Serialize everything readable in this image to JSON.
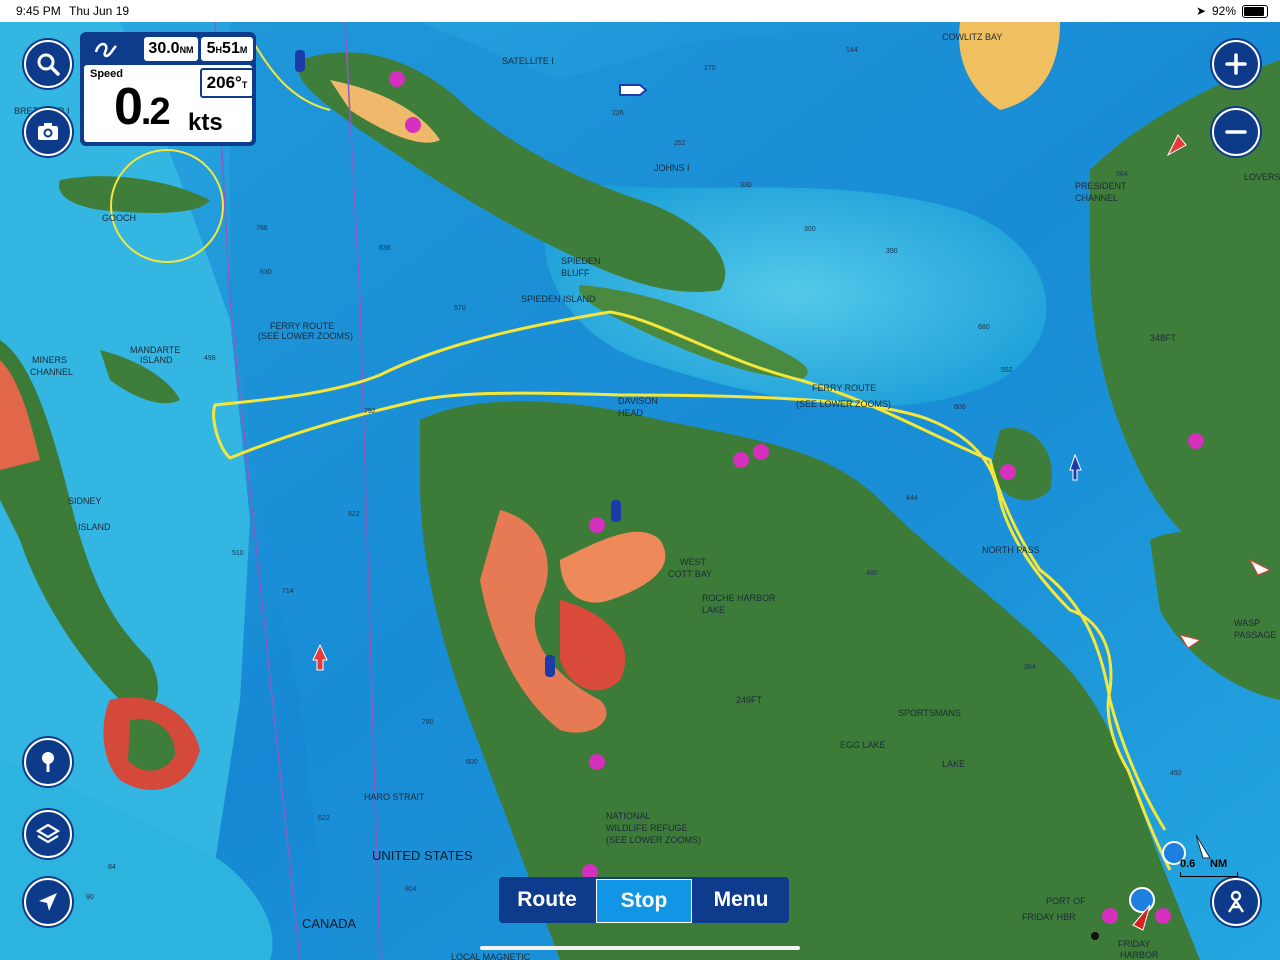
{
  "status_bar": {
    "time": "9:45 PM",
    "date": "Thu Jun 19",
    "battery": "92%"
  },
  "trip_panel": {
    "distance_value": "30.0",
    "distance_unit": "NM",
    "duration_hours": "5",
    "duration_h": "H",
    "duration_minutes": "51",
    "duration_m": "M",
    "speed_label": "Speed",
    "speed_int": "0",
    "speed_dec": ".2",
    "speed_unit": "kts",
    "heading": "206°",
    "heading_ref": "T"
  },
  "controls": {
    "search": "search-icon",
    "camera": "camera-icon",
    "zoom_in": "plus-icon",
    "zoom_out": "minus-icon",
    "pin": "pin-icon",
    "layers": "layers-icon",
    "locate": "location-arrow-icon",
    "avatar": "person-icon"
  },
  "tabs": [
    {
      "label": "Route",
      "active": false
    },
    {
      "label": "Stop",
      "active": true
    },
    {
      "label": "Menu",
      "active": false
    }
  ],
  "scale_bar": {
    "value": "0.6",
    "unit": "NM"
  },
  "map_labels": [
    "COWLITZ BAY",
    "SATELLITE I",
    "JOHNS I",
    "PRESIDENT",
    "CHANNEL",
    "SPIEDEN",
    "BLUFF",
    "SPIEDEN ISLAND",
    "FERRY ROUTE",
    "(SEE LOWER ZOOMS)",
    "MANDARTE",
    "ISLAND",
    "MINERS",
    "CHANNEL",
    "SIDNEY",
    "ISLAND",
    "DAVISON",
    "HEAD",
    "FERRY ROUTE",
    "(SEE LOWER ZOOMS)",
    "WEST",
    "COTT BAY",
    "ROCHE HARBOR",
    "LAKE",
    "NORTH PASS",
    "WASP",
    "PASSAGE",
    "249FT",
    "348FT",
    "SPORTSMANS",
    "LAKE",
    "EGG LAKE",
    "HARO STRAIT",
    "NATIONAL",
    "WILDLIFE REFUGE",
    "(SEE LOWER ZOOMS)",
    "UNITED STATES",
    "CANADA",
    "PORT OF",
    "FRIDAY HBR",
    "FRIDAY",
    "HARBOR",
    "LOCAL MAGNETIC",
    "GOOCH",
    "BRETHOUR I",
    "LOVERS"
  ],
  "depths": [
    "270",
    "226",
    "252",
    "144",
    "330",
    "300",
    "390",
    "680",
    "552",
    "606",
    "564",
    "498",
    "792",
    "822",
    "630",
    "636",
    "570",
    "444",
    "480",
    "384",
    "492",
    "510",
    "714",
    "780",
    "786",
    "804",
    "622",
    "84",
    "90",
    "600"
  ],
  "colors": {
    "water_deep": "#1a8fd0",
    "water_shallow": "#39c2e8",
    "land": "#3f7d3a",
    "shoal": "#e86a4a",
    "track": "#f5e63a",
    "panel": "#0f3b8c"
  }
}
